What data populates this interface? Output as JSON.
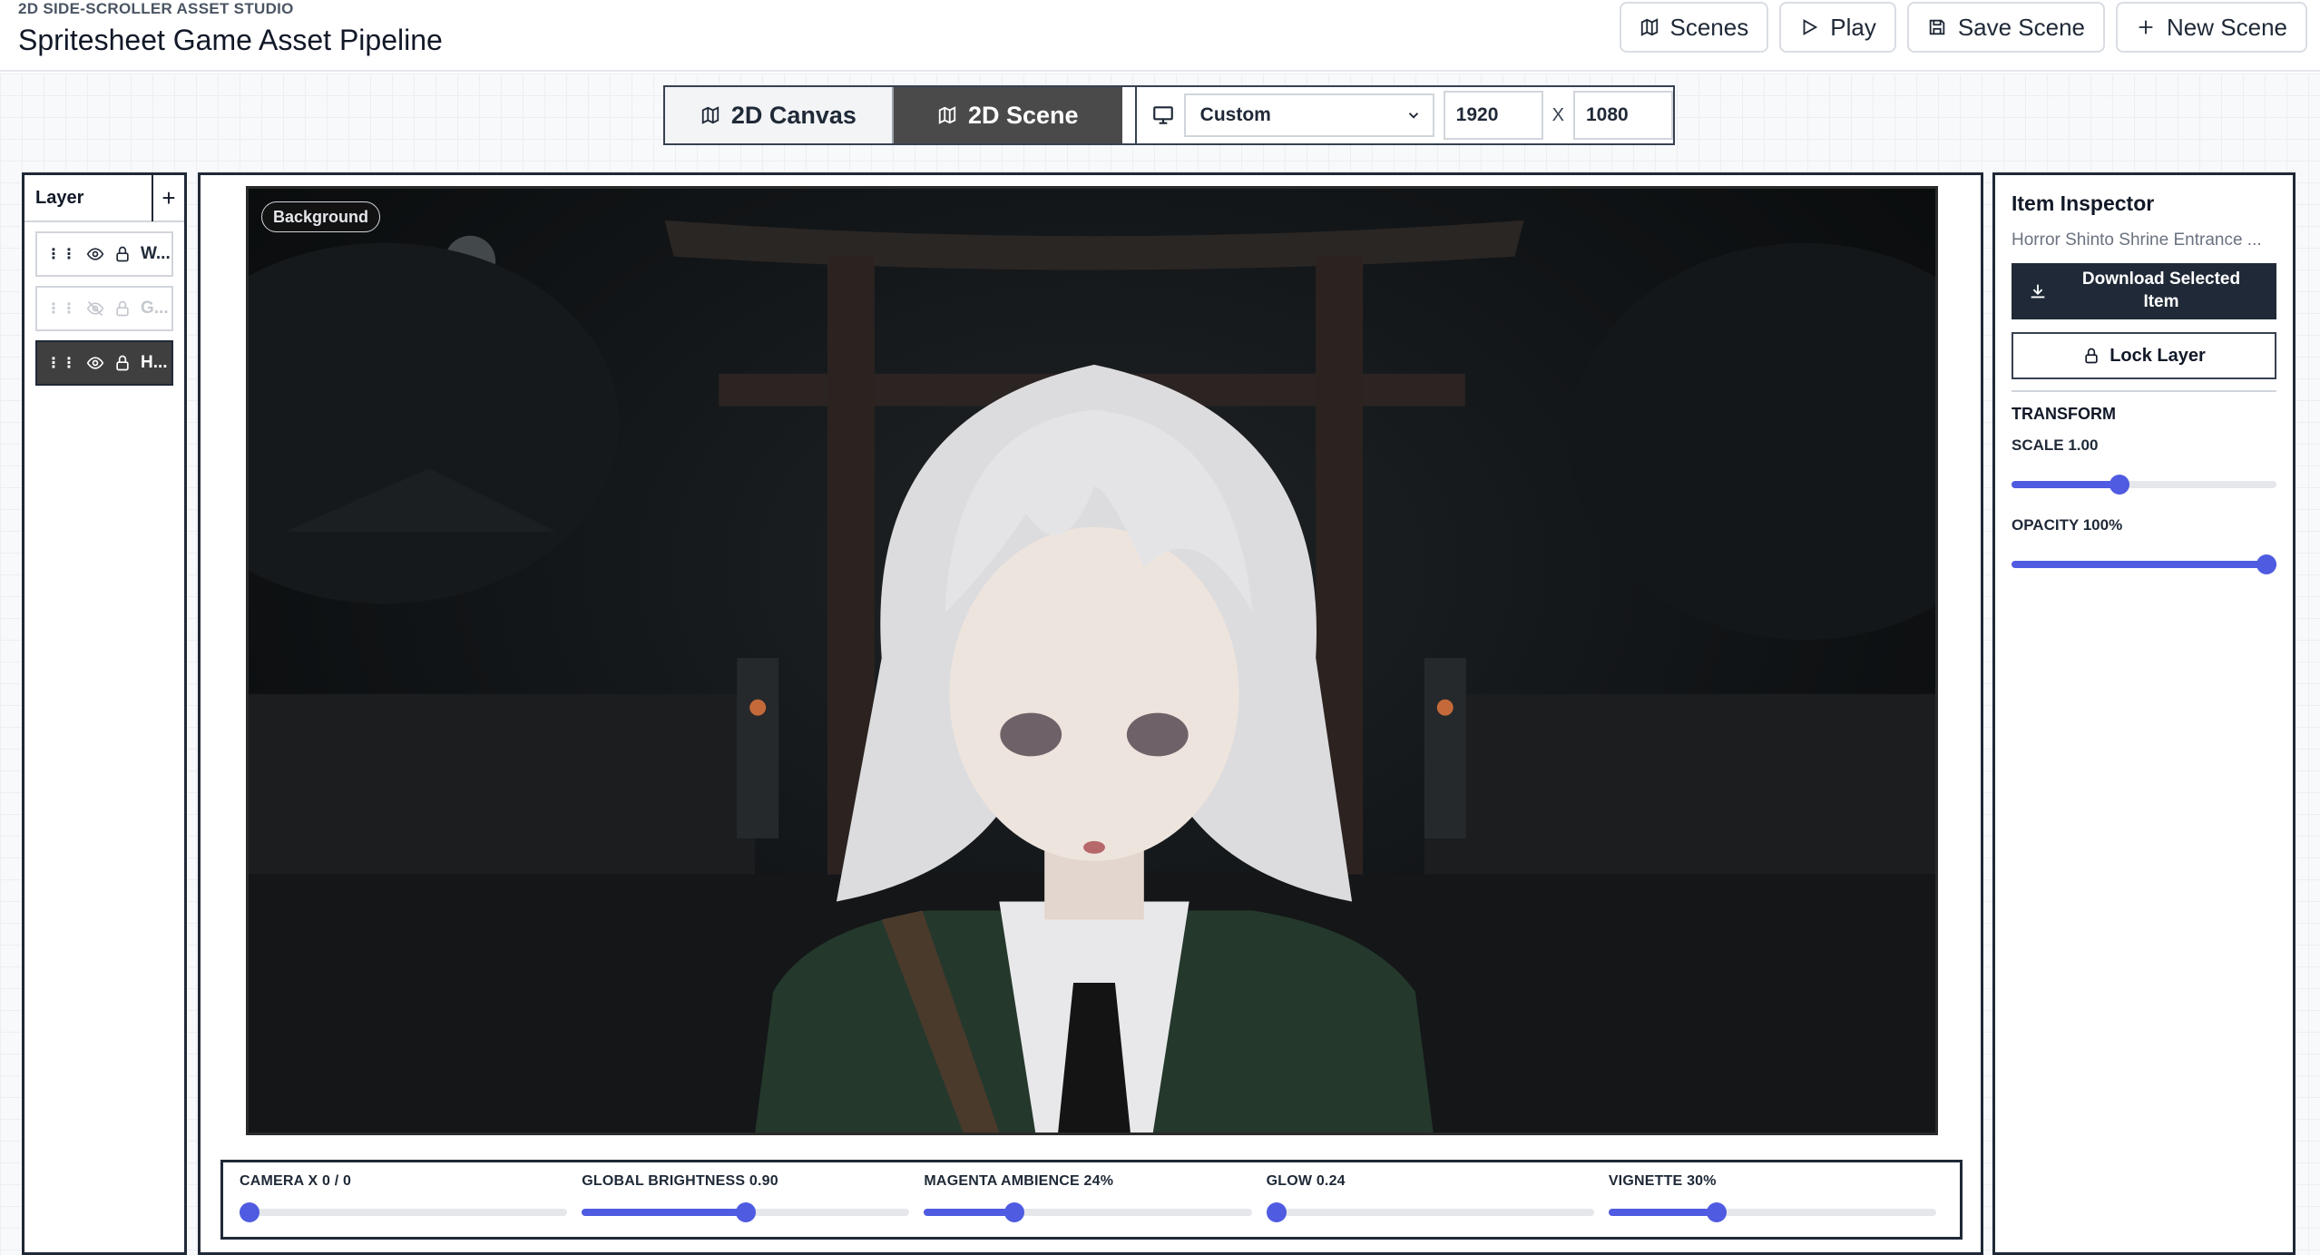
{
  "header": {
    "studio_label": "2D SIDE-SCROLLER ASSET STUDIO",
    "title": "Spritesheet Game Asset Pipeline",
    "actions": {
      "scenes": "Scenes",
      "play": "Play",
      "save_scene": "Save Scene",
      "new_scene": "New Scene"
    }
  },
  "mode_bar": {
    "tab_canvas": "2D Canvas",
    "tab_scene": "2D Scene",
    "active_tab": "2D Scene",
    "resolution_preset": "Custom",
    "width": "1920",
    "separator": "X",
    "height": "1080"
  },
  "layers": {
    "title": "Layer",
    "add_label": "+",
    "items": [
      {
        "grip": "⋮⋮",
        "label": "W...",
        "visible": true,
        "selected": false
      },
      {
        "grip": "⋮⋮",
        "label": "G...",
        "visible": false,
        "selected": false
      },
      {
        "grip": "⋮⋮",
        "label": "H...",
        "visible": true,
        "selected": true
      }
    ]
  },
  "scene": {
    "badge": "Background"
  },
  "effects": {
    "camera": {
      "label": "CAMERA X 0 / 0",
      "value": 0.0
    },
    "brightness": {
      "label": "GLOBAL BRIGHTNESS 0.90",
      "value": 0.5
    },
    "magenta": {
      "label": "MAGENTA AMBIENCE 24%",
      "value": 0.26
    },
    "glow": {
      "label": "GLOW 0.24",
      "value": 0.0
    },
    "vignette": {
      "label": "VIGNETTE 30%",
      "value": 0.32
    }
  },
  "inspector": {
    "title": "Item Inspector",
    "item_name": "Horror Shinto Shrine Entrance ...",
    "download_label": "Download Selected Item",
    "lock_label": "Lock Layer",
    "section": "TRANSFORM",
    "scale": {
      "label": "SCALE 1.00",
      "value": 0.4
    },
    "opacity": {
      "label": "OPACITY 100%",
      "value": 1.0
    }
  },
  "colors": {
    "accent": "#4f5be0",
    "dark": "#1f2937",
    "active_tab": "#4a4a4a"
  }
}
